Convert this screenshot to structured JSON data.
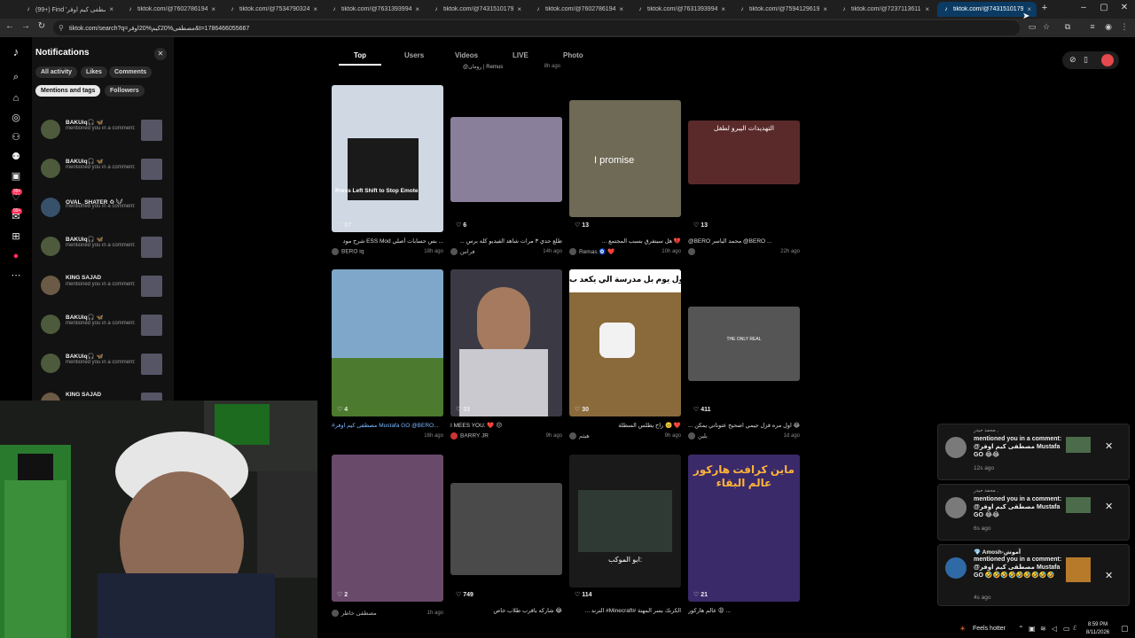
{
  "browser": {
    "tabs": [
      {
        "title": "(99+) Find 'مصطفى كيم اوفر'",
        "active": false
      },
      {
        "title": "tiktok.com/@76027861942...",
        "active": false
      },
      {
        "title": "tiktok.com/@75347903248...",
        "active": false
      },
      {
        "title": "tiktok.com/@76313939947...",
        "active": false
      },
      {
        "title": "tiktok.com/@74315101798...",
        "active": false
      },
      {
        "title": "tiktok.com/@76027861942...",
        "active": false
      },
      {
        "title": "tiktok.com/@76313939947...",
        "active": false
      },
      {
        "title": "tiktok.com/@75941296197...",
        "active": false
      },
      {
        "title": "tiktok.com/@72371136116...",
        "active": false
      },
      {
        "title": "tiktok.com/@74315101798...",
        "active": true
      }
    ],
    "new_tab": "+",
    "window_controls": {
      "minimize": "–",
      "maximize": "▢",
      "close": "✕"
    },
    "address": "tiktok.com/search?q=مصطفى%20كيم%20اوفر&t=1786466055667",
    "nav": {
      "back": "←",
      "forward": "→",
      "reload": "↻"
    }
  },
  "rail": {
    "logo_glyph": "♪",
    "icons": [
      {
        "name": "search-icon",
        "glyph": "⌕"
      },
      {
        "name": "home-icon",
        "glyph": "⌂"
      },
      {
        "name": "explore-icon",
        "glyph": "◎"
      },
      {
        "name": "following-icon",
        "glyph": "⚇"
      },
      {
        "name": "friends-icon",
        "glyph": "⚉"
      },
      {
        "name": "live-icon",
        "glyph": "▣"
      },
      {
        "name": "activity-icon",
        "glyph": "♡"
      },
      {
        "name": "messages-icon",
        "glyph": "✉"
      },
      {
        "name": "upload-icon",
        "glyph": "⊞"
      },
      {
        "name": "profile-icon",
        "glyph": "●"
      },
      {
        "name": "more-icon",
        "glyph": "⋯"
      }
    ],
    "badge1": "99+",
    "badge2": "99+"
  },
  "notifications": {
    "title": "Notifications",
    "close": "✕",
    "filters": [
      "All activity",
      "Likes",
      "Comments",
      "Mentions and tags",
      "Followers"
    ],
    "selected_filter": "Mentions and tags",
    "items": [
      {
        "name": "BAKUiq🎧 🦋",
        "text": "mentioned you in a comment: @مصطفى كيم اوفر",
        "color": "#4d5a3c"
      },
      {
        "name": "BAKUiq🎧 🦋",
        "text": "mentioned you in a comment: @مصطفى كيم اوفر",
        "color": "#4d5a3c"
      },
      {
        "name": "OVAL_SHATER ♻ 𓆩𓆪",
        "text": "mentioned you in a comment: @مصطفى كيم اوفر",
        "color": "#37516b"
      },
      {
        "name": "BAKUiq🎧 🦋",
        "text": "mentioned you in a comment: @مصطفى كيم اوفر",
        "color": "#4d5a3c"
      },
      {
        "name": "KING SAJAD",
        "text": "mentioned you in a comment: @مصطفى كيم اوفر",
        "color": "#6b5a45"
      },
      {
        "name": "BAKUiq🎧 🦋",
        "text": "mentioned you in a comment: @مصطفى كيم اوفر",
        "color": "#4d5a3c"
      },
      {
        "name": "BAKUiq🎧 🦋",
        "text": "mentioned you in a comment: @مصطفى كيم اوفر",
        "color": "#4d5a3c"
      },
      {
        "name": "KING SAJAD",
        "text": "",
        "color": "#6b5a45"
      }
    ]
  },
  "search": {
    "tabs": [
      "Top",
      "Users",
      "Videos",
      "LIVE",
      "Photo"
    ],
    "selected": "Top",
    "partial_top_author": "@رومان | Remus",
    "partial_top_age": "8h ago"
  },
  "videos": [
    {
      "likes": "57",
      "desc": "شرح مود ESS Mod بس حسابات أصلي ...",
      "author": "BERO iq",
      "age": "18h ago",
      "overlay": "Press Left Shift to Stop Emote",
      "color": "#cfd8e3"
    },
    {
      "likes": "6",
      "desc": "... طلع حدي ٣ مرات شاهد الفيديو كله برس",
      "author": "فراس",
      "age": "14h ago",
      "overlay": "",
      "color": "#8a7f9a"
    },
    {
      "likes": "13",
      "desc": "... هل سيتفرق بسبب المجتمع 💔",
      "author": "Remas 🧿 ❤️",
      "age": "10h ago",
      "overlay": "I promise",
      "color": "#6f6a55"
    },
    {
      "likes": "13",
      "desc": "@BERO محمد الياسر @BERO ...",
      "author": "",
      "age": "22h ago",
      "overlay": "التهديدات اليبرو لطفل",
      "color": "#5a2a2a"
    },
    {
      "likes": "4",
      "desc": "#مصطفى كيم اوفر Mustafa GO @BERO...",
      "author": "",
      "age": "16h ago",
      "overlay": "",
      "color": "#7fa7c9"
    },
    {
      "likes": "33",
      "desc": "I MEES YOU. ❤️ 😔",
      "author": "BARRY JR",
      "age": "9h ago",
      "overlay": "",
      "color": "#3b3a44"
    },
    {
      "likes": "30",
      "desc": "راح يطلس السطلة 🥺 ❤️",
      "author": "هيثم",
      "age": "9h ago",
      "overlay": "اول يوم بل مدرسة الي يكعد ب",
      "color": "#8a6a3a"
    },
    {
      "likes": "411",
      "desc": "... اول مره قزل جيمي اصحيح عتوناتي يمكن 😂",
      "author": "بلين",
      "age": "1d ago",
      "overlay": "THE ONLY REAL",
      "color": "#555555"
    },
    {
      "likes": "2",
      "desc": "",
      "author": "مصطفى خاطر",
      "age": "1h ago",
      "overlay": "",
      "color": "#6a4a6a"
    },
    {
      "likes": "749",
      "desc": "شاركه باقرب طلاب خاص 😂",
      "author": "",
      "age": "",
      "overlay": "",
      "color": "#4a4a4a"
    },
    {
      "likes": "114",
      "desc": "... الترند #Minecraft# الكرنك بسر المهنة",
      "author": "",
      "age": "",
      "overlay": "ابو الموكب:",
      "color": "#1a1a1a"
    },
    {
      "likes": "21",
      "desc": "عالم هاركور 😩 ...",
      "author": "",
      "age": "",
      "overlay": "ماين كرافت هاركور عالم البقاء",
      "color": "#3a2a6a"
    }
  ],
  "toasts": [
    {
      "small": "محمد حيدر , ",
      "body": "mentioned you in a comment: @مصطفى كيم اوفر Mustafa GO 😂😂",
      "age": "12s ago"
    },
    {
      "small": "محمد حيدر , ",
      "body": "mentioned you in a comment: @مصطفى كيم اوفر Mustafa GO 😂😂",
      "age": "6s ago"
    },
    {
      "small": "💎 Amosh-آموش",
      "body": "mentioned you in a comment: @مصطفى كيم اوفر Mustafa GO 🤣🤣🤣🤣🤣🤣🤣🤣🤣",
      "age": "4s ago"
    }
  ],
  "taskbar": {
    "weather": "Feels hotter",
    "time": "8:59 PM",
    "date": "8/11/2026"
  }
}
